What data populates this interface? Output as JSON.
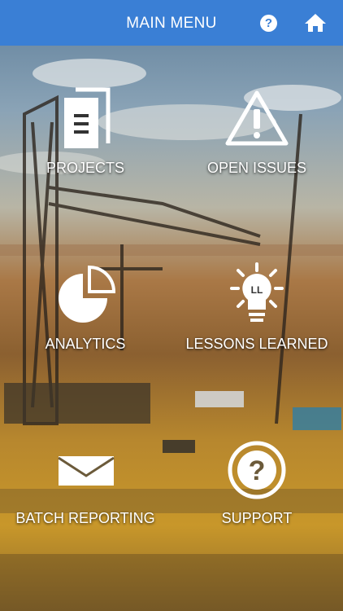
{
  "header": {
    "title": "MAIN MENU",
    "help_icon": "help-icon",
    "home_icon": "home-icon"
  },
  "menu": [
    {
      "label": "PROJECTS",
      "icon": "documents-icon"
    },
    {
      "label": "OPEN ISSUES",
      "icon": "warning-icon"
    },
    {
      "label": "ANALYTICS",
      "icon": "pie-chart-icon"
    },
    {
      "label": "LESSONS LEARNED",
      "icon": "lightbulb-icon",
      "icon_text": "LL"
    },
    {
      "label": "BATCH REPORTING",
      "icon": "envelope-icon"
    },
    {
      "label": "SUPPORT",
      "icon": "question-circle-icon"
    }
  ],
  "colors": {
    "header": "#3a7fd5",
    "text": "#ffffff"
  }
}
